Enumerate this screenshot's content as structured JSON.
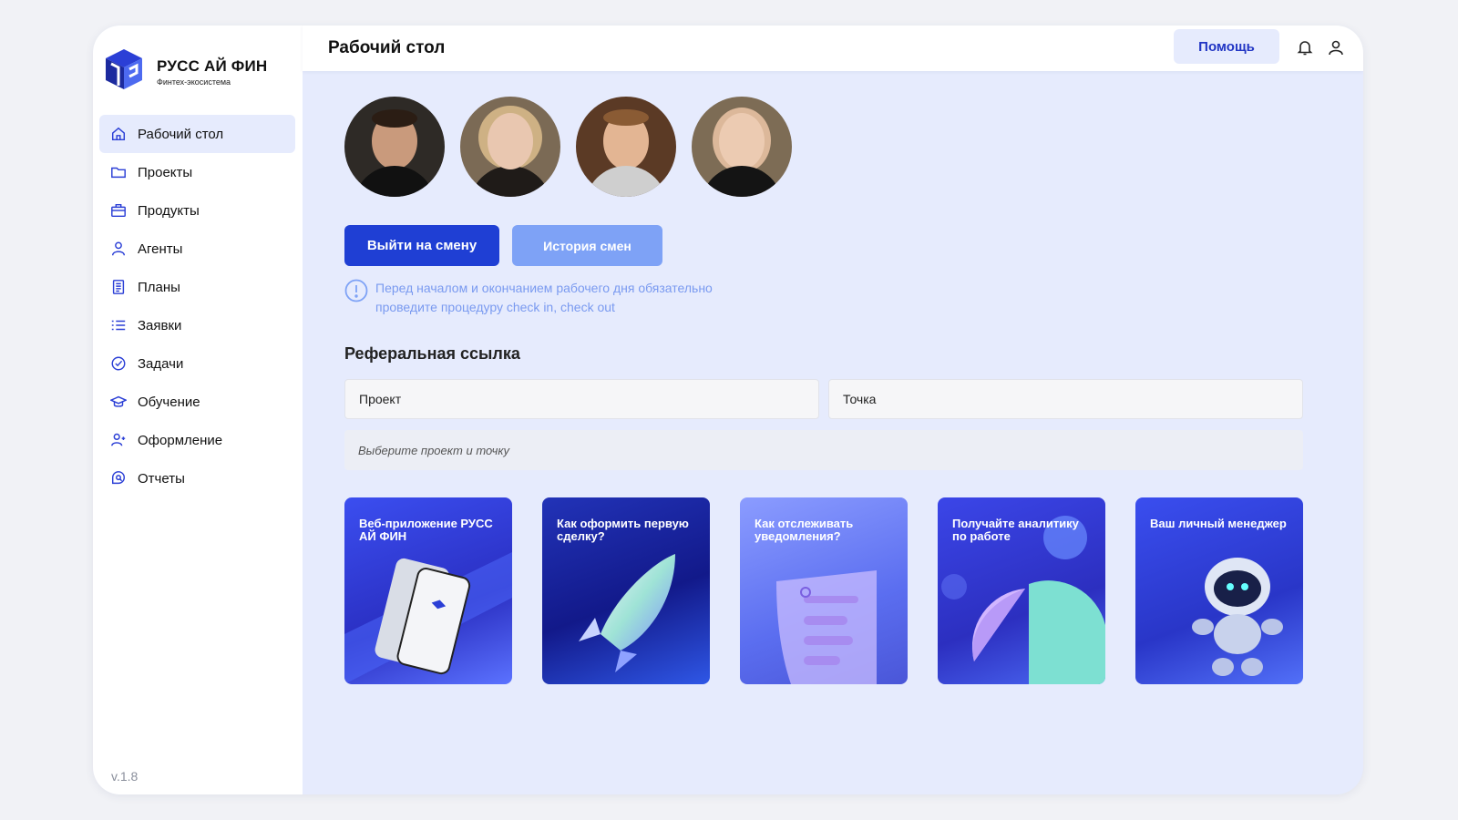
{
  "app": {
    "logo_title": "РУСС АЙ ФИН",
    "logo_subtitle": "Финтех-экосистема",
    "version": "v.1.8"
  },
  "sidebar": {
    "items": [
      {
        "label": "Рабочий стол",
        "icon": "home-icon",
        "active": true
      },
      {
        "label": "Проекты",
        "icon": "folder-icon"
      },
      {
        "label": "Продукты",
        "icon": "briefcase-icon"
      },
      {
        "label": "Агенты",
        "icon": "user-icon"
      },
      {
        "label": "Планы",
        "icon": "document-icon"
      },
      {
        "label": "Заявки",
        "icon": "list-icon"
      },
      {
        "label": "Задачи",
        "icon": "check-circle-icon"
      },
      {
        "label": "Обучение",
        "icon": "graduation-cap-icon"
      },
      {
        "label": "Оформление",
        "icon": "user-add-icon"
      },
      {
        "label": "Отчеты",
        "icon": "chat-search-icon"
      }
    ]
  },
  "header": {
    "title": "Рабочий стол",
    "help_label": "Помощь",
    "icons": [
      "bell-icon",
      "profile-icon"
    ]
  },
  "shift": {
    "start_label": "Выйти на смену",
    "history_label": "История смен",
    "notice": "Перед началом и окончанием рабочего дня обязательно проведите процедуру check in, check out",
    "notice_icon": "info-icon"
  },
  "referral": {
    "title": "Реферальная ссылка",
    "project_placeholder": "Проект",
    "point_placeholder": "Точка",
    "hint": "Выберите проект и точку"
  },
  "cards": [
    {
      "title": "Веб-приложение РУСС АЙ ФИН"
    },
    {
      "title": "Как оформить первую сделку?"
    },
    {
      "title": "Как отслеживать уведомления?"
    },
    {
      "title": "Получайте аналитику по работе"
    },
    {
      "title": "Ваш личный менеджер"
    }
  ],
  "colors": {
    "accent": "#1f3fd4",
    "accent_light": "#7ea2f6",
    "background": "#e6ebfd"
  }
}
